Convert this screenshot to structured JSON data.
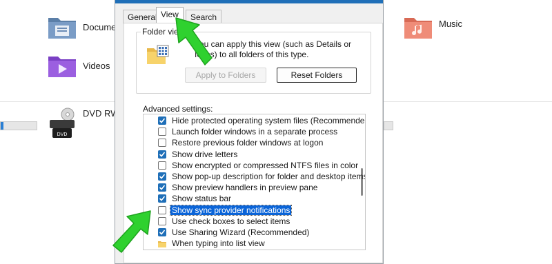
{
  "explorer": {
    "items": [
      {
        "label": "Documents",
        "icon": "documents-folder-icon"
      },
      {
        "label": "Videos",
        "icon": "videos-folder-icon"
      },
      {
        "label": "DVD RW",
        "icon": "dvd-drive-icon"
      },
      {
        "label": "Music",
        "icon": "music-folder-icon"
      }
    ],
    "dvd_badge": "DVD"
  },
  "dialog": {
    "tabs": [
      {
        "label": "General",
        "active": false
      },
      {
        "label": "View",
        "active": true
      },
      {
        "label": "Search",
        "active": false
      }
    ],
    "folder_views": {
      "title": "Folder views",
      "description": "You can apply this view (such as Details or Icons) to all folders of this type.",
      "apply_button": "Apply to Folders",
      "reset_button": "Reset Folders"
    },
    "advanced_label": "Advanced settings:",
    "settings": [
      {
        "label": "Hide protected operating system files (Recommended)",
        "checked": true
      },
      {
        "label": "Launch folder windows in a separate process",
        "checked": false
      },
      {
        "label": "Restore previous folder windows at logon",
        "checked": false
      },
      {
        "label": "Show drive letters",
        "checked": true
      },
      {
        "label": "Show encrypted or compressed NTFS files in color",
        "checked": false
      },
      {
        "label": "Show pop-up description for folder and desktop items",
        "checked": true
      },
      {
        "label": "Show preview handlers in preview pane",
        "checked": true
      },
      {
        "label": "Show status bar",
        "checked": true
      },
      {
        "label": "Show sync provider notifications",
        "checked": false,
        "selected": true
      },
      {
        "label": "Use check boxes to select items",
        "checked": false
      },
      {
        "label": "Use Sharing Wizard (Recommended)",
        "checked": true
      },
      {
        "label": "When typing into list view",
        "folder": true
      }
    ]
  },
  "colors": {
    "accent": "#1f6fb8",
    "selection": "#0a64d8",
    "annotation_arrow": "#2fd12f"
  }
}
